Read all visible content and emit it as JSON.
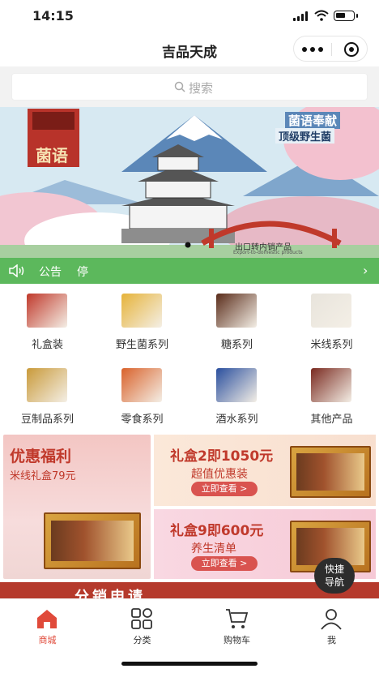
{
  "status_bar": {
    "time": "14:15"
  },
  "nav": {
    "title": "吉品天成"
  },
  "search": {
    "placeholder": "搜索"
  },
  "banner": {
    "brand_logo_text": "菌语",
    "slogan_line1": "菌语奉献",
    "slogan_line2": "顶级野生菌",
    "caption": "出口转内销产品",
    "caption_sub": "Export-to-domestic products"
  },
  "notice": {
    "label": "公告",
    "text": "停"
  },
  "categories": [
    {
      "label": "礼盒装",
      "color": "#c0392b"
    },
    {
      "label": "野生菌系列",
      "color": "#e6b33a"
    },
    {
      "label": "糖系列",
      "color": "#5a2c1a"
    },
    {
      "label": "米线系列",
      "color": "#e8e4dc"
    },
    {
      "label": "豆制品系列",
      "color": "#c99a3a"
    },
    {
      "label": "零食系列",
      "color": "#d9622b"
    },
    {
      "label": "酒水系列",
      "color": "#2a4f9e"
    },
    {
      "label": "其他产品",
      "color": "#7a2a20"
    }
  ],
  "promos": {
    "left": {
      "title": "优惠福利",
      "subtitle": "米线礼盒79元"
    },
    "top_right": {
      "title": "礼盒2即1050元",
      "subtitle": "超值优惠装",
      "button": "立即查看 >"
    },
    "bottom_right": {
      "title": "礼盒9即600元",
      "subtitle": "养生清单",
      "button": "立即查看 >"
    }
  },
  "fab": {
    "line1": "快捷",
    "line2": "导航"
  },
  "distribution": {
    "text": "分销申请"
  },
  "tabbar": [
    {
      "label": "商城",
      "icon": "home-icon",
      "active": true
    },
    {
      "label": "分类",
      "icon": "category-icon",
      "active": false
    },
    {
      "label": "购物车",
      "icon": "cart-icon",
      "active": false
    },
    {
      "label": "我",
      "icon": "user-icon",
      "active": false
    }
  ],
  "colors": {
    "accent": "#e04a3a",
    "notice_bg": "#5cb85c",
    "brand_red": "#c0392b"
  }
}
